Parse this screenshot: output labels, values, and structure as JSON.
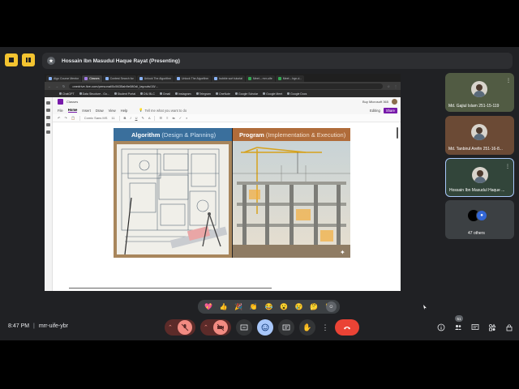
{
  "meet": {
    "presenter_label": "Hossain Ibn Masudul Haque Rayat (Presenting)",
    "meeting_time": "8:47 PM",
    "meeting_separator": "|",
    "meeting_code": "mrr-uife-ybr",
    "people_badge": "51",
    "reactions": [
      "💖",
      "👍",
      "🎉",
      "👏",
      "😂",
      "😮",
      "😢",
      "🤔",
      "👎"
    ],
    "participants": [
      {
        "name": "Md. Gajiul Islam 251-15-119"
      },
      {
        "name": "Md. Tanbirul Arefin 251-16-8..."
      },
      {
        "name": "Hossain Ibn Masudul Haque ..."
      },
      {
        "name": "47 others"
      }
    ]
  },
  "browser": {
    "tabs": [
      {
        "label": "Algo Course Mentor",
        "style": "normal"
      },
      {
        "label": "Classes",
        "style": "active"
      },
      {
        "label": "Contest Search for",
        "style": "normal"
      },
      {
        "label": "Unlock The Algorithm",
        "style": "normal"
      },
      {
        "label": "Unlock The Algorithm",
        "style": "normal"
      },
      {
        "label": "bubble sort tutorial",
        "style": "normal"
      },
      {
        "label": "Meet – mrr-uife",
        "style": "green"
      },
      {
        "label": "Meet – bgn-d...",
        "style": "green"
      }
    ],
    "url": "onedrive.live.com/personal/0c5635ab9e080d/_layouts/15/...",
    "bookmarks": [
      "ChatGPT",
      "Data Structure - Go...",
      "Student Portal",
      "DIU BLC",
      "Gmail",
      "Instagram",
      "Telegram",
      "OneNote",
      "Google Scholar",
      "Google Meet",
      "Google Docs"
    ]
  },
  "onenote": {
    "app_name": "Classes",
    "buy_label": "Buy Microsoft 365",
    "ribbon_tabs": [
      "File",
      "Home",
      "Insert",
      "Draw",
      "View",
      "Help"
    ],
    "tell_me": "Tell me what you want to do",
    "editing_label": "Editing",
    "share_label": "Share",
    "font_name": "Comic Sans MS",
    "font_size": "11"
  },
  "slide": {
    "left_title": "Algorithm",
    "left_subtitle": "(Design & Planning)",
    "right_title": "Program",
    "right_subtitle": "(Implementation & Execution)"
  },
  "colors": {
    "algorithm_header": "#3a6f9c",
    "program_header": "#b06c3a",
    "end_call": "#ea4335",
    "accent_blue": "#a8c7fa"
  }
}
